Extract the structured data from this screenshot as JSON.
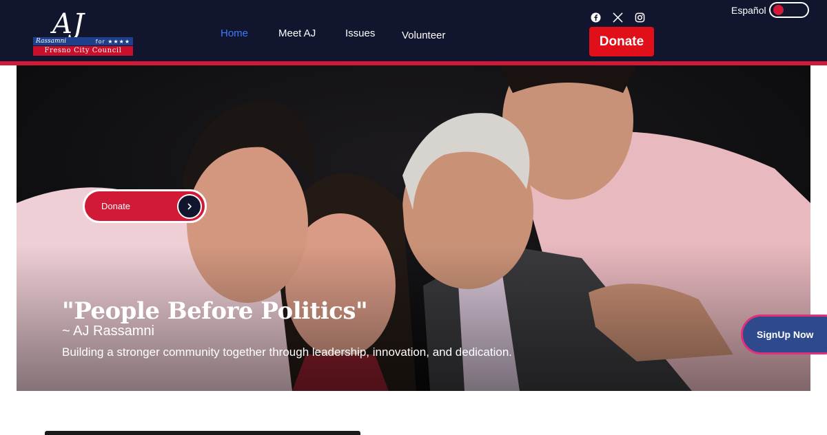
{
  "logo": {
    "initials": "AJ",
    "name": "Rassamni",
    "stars": "for ★★★★",
    "council": "Fresno City Council"
  },
  "nav": {
    "items": [
      {
        "label": "Home",
        "active": true
      },
      {
        "label": "Meet AJ",
        "active": false
      },
      {
        "label": "Issues",
        "active": false
      },
      {
        "label": "Volunteer",
        "active": false
      }
    ]
  },
  "social": [
    "facebook-icon",
    "x-icon",
    "instagram-icon"
  ],
  "header": {
    "donate_label": "Donate",
    "language_label": "Español"
  },
  "hero": {
    "donate_label": "Donate",
    "quote": "\"People Before Politics\"",
    "author": "~ AJ Rassamni",
    "tagline": "Building a stronger community together through leadership, innovation, and dedication.",
    "signup_label": "SignUp Now"
  },
  "colors": {
    "navy": "#12152e",
    "red": "#d11a36",
    "active_link": "#3b7bff",
    "signup": "#2e4a8c",
    "signup_border": "#e0307a"
  }
}
